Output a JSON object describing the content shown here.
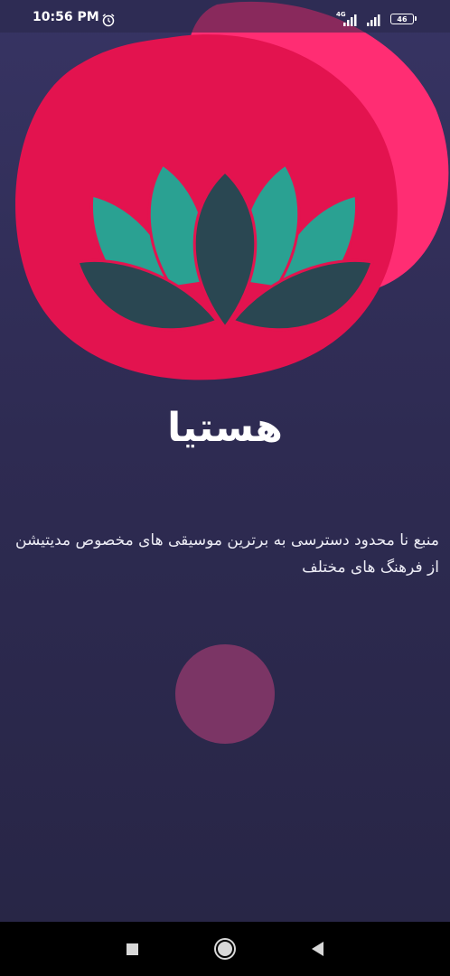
{
  "status_bar": {
    "time": "10:56 PM",
    "network_label": "4G",
    "battery_level": "46",
    "icons": [
      "alarm-icon",
      "signal-icon",
      "signal-icon",
      "battery-icon"
    ]
  },
  "hero": {
    "icon": "lotus-icon",
    "colors": {
      "blob_primary": "#e3134f",
      "blob_secondary": "#ff2d73",
      "petal": "#2aa192",
      "petal_dark": "#2a4752"
    }
  },
  "main": {
    "app_title": "هستیا",
    "tagline": "منبع نا محدود دسترسی به برترین موسیقی های مخصوص مدیتیشن از فرهنگ های مختلف"
  },
  "start_button": {
    "color": "#7b3565"
  },
  "nav_bar": {
    "icons": [
      "recent-apps-icon",
      "home-icon",
      "back-icon"
    ]
  },
  "colors": {
    "background_top": "#373463",
    "background_bottom": "#272545"
  }
}
